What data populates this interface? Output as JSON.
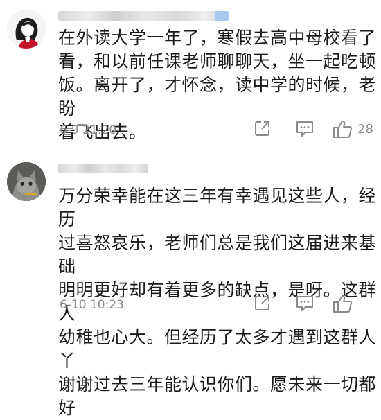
{
  "comments": [
    {
      "text": "在外读大学一年了，寒假去高中母校看了看，和以前任课老师聊聊天，坐一起吃顿饭。离开了，才怀念，读中学的时候，老盼着飞出去。",
      "lines": [
        "在外读大学一年了，寒假去高中母校看了",
        "看，和以前任课老师聊聊天，坐一起吃顿",
        "饭。离开了，才怀念，读中学的时候，老盼",
        "着飞出去。"
      ],
      "timestamp": "6-9 21:20",
      "likes": "28",
      "avatar_icon": "cartoon-girl-avatar"
    },
    {
      "lines": [
        "万分荣幸能在这三年有幸遇见这些人，经历",
        "过喜怒哀乐，老师们总是我们这届进来基础",
        "明明更好却有着更多的缺点，是呀。这群人",
        "幼稚也心大。但经历了太多才遇到这群人丫",
        "谢谢过去三年能认识你们。愿未来一切都好"
      ],
      "timestamp": "6-10 10:23",
      "likes": "",
      "avatar_icon": "cat-avatar"
    }
  ],
  "icons": {
    "share": "share-icon",
    "comment": "comment-icon",
    "like": "like-icon"
  },
  "colors": {
    "meta_text": "#8a8a8a",
    "icon_stroke": "#8a8a8a",
    "name_highlight": "#a9c9f0"
  }
}
